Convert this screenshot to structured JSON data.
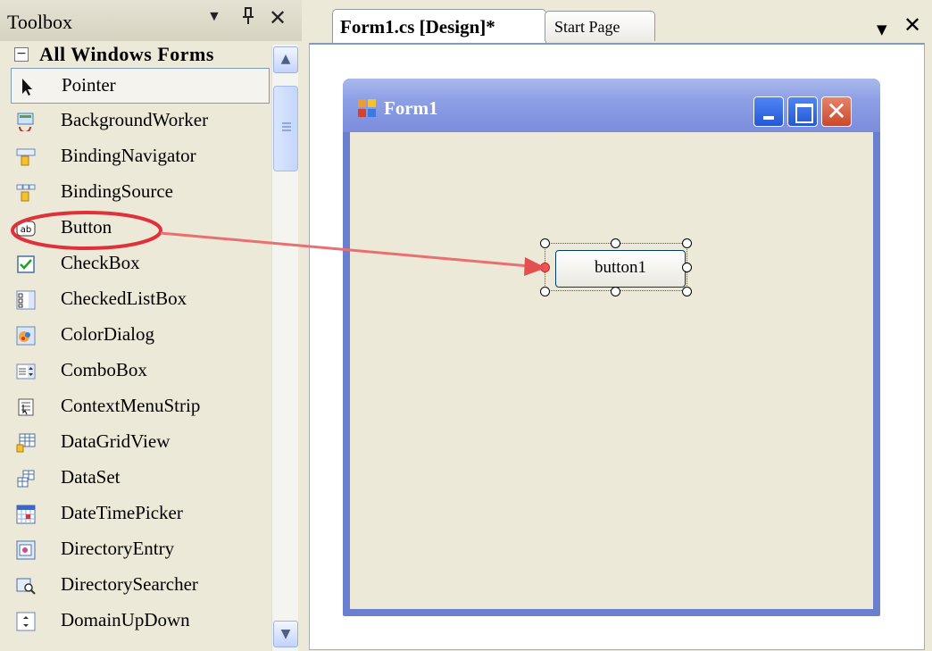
{
  "toolbox": {
    "title": "Toolbox",
    "group": "All Windows Forms",
    "items": [
      {
        "label": "Pointer",
        "icon": "pointer-icon"
      },
      {
        "label": "BackgroundWorker",
        "icon": "background-worker-icon"
      },
      {
        "label": "BindingNavigator",
        "icon": "binding-navigator-icon"
      },
      {
        "label": "BindingSource",
        "icon": "binding-source-icon"
      },
      {
        "label": "Button",
        "icon": "button-icon"
      },
      {
        "label": "CheckBox",
        "icon": "checkbox-icon"
      },
      {
        "label": "CheckedListBox",
        "icon": "checked-listbox-icon"
      },
      {
        "label": "ColorDialog",
        "icon": "color-dialog-icon"
      },
      {
        "label": "ComboBox",
        "icon": "combobox-icon"
      },
      {
        "label": "ContextMenuStrip",
        "icon": "context-menu-icon"
      },
      {
        "label": "DataGridView",
        "icon": "datagrid-icon"
      },
      {
        "label": "DataSet",
        "icon": "dataset-icon"
      },
      {
        "label": "DateTimePicker",
        "icon": "datetime-picker-icon"
      },
      {
        "label": "DirectoryEntry",
        "icon": "directory-entry-icon"
      },
      {
        "label": "DirectorySearcher",
        "icon": "directory-searcher-icon"
      },
      {
        "label": "DomainUpDown",
        "icon": "domain-updown-icon"
      }
    ],
    "selected_index": 0
  },
  "tabs": {
    "active": "Form1.cs [Design]*",
    "inactive": "Start Page"
  },
  "form": {
    "title": "Form1",
    "button_text": "button1",
    "close_glyph": "✕"
  },
  "button_icon_text": "ab",
  "colors": {
    "annotation": "#e0303a",
    "form_border": "#6b7fcf",
    "window_button": "#2457d6",
    "close_button": "#c9482c"
  }
}
